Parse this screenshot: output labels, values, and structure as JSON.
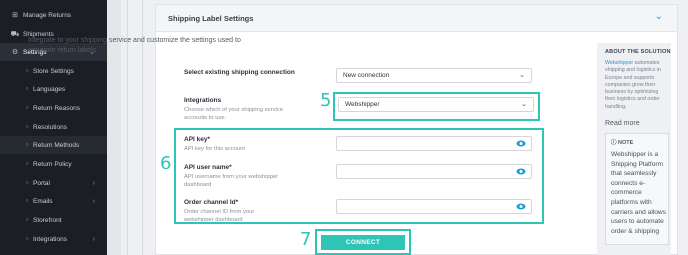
{
  "sidebar": {
    "items": [
      {
        "label": "Manage Returns",
        "icon": "returns-icon",
        "glyph": "⊞"
      },
      {
        "label": "Shipments",
        "icon": "truck-icon",
        "glyph": "⛟"
      },
      {
        "label": "Settings",
        "icon": "gear-icon",
        "glyph": "⚙"
      },
      {
        "label": "Store Settings",
        "icon": "dot-icon",
        "glyph": "○"
      },
      {
        "label": "Languages",
        "icon": "dot-icon",
        "glyph": "○"
      },
      {
        "label": "Return Reasons",
        "icon": "dot-icon",
        "glyph": "○"
      },
      {
        "label": "Resolutions",
        "icon": "dot-icon",
        "glyph": "○"
      },
      {
        "label": "Return Methods",
        "icon": "dot-icon",
        "glyph": "○"
      },
      {
        "label": "Return Policy",
        "icon": "dot-icon",
        "glyph": "○"
      },
      {
        "label": "Portal",
        "icon": "dot-icon",
        "glyph": "○"
      },
      {
        "label": "Emails",
        "icon": "dot-icon",
        "glyph": "○"
      },
      {
        "label": "Storefront",
        "icon": "dot-icon",
        "glyph": "○"
      },
      {
        "label": "Integrations",
        "icon": "dot-icon",
        "glyph": "○"
      }
    ]
  },
  "panel": {
    "title": "Shipping Label Settings",
    "intro": "Integrate to your shipping service and customize the settings used to generate return labels.",
    "existing_connection": {
      "label": "Select existing shipping connection",
      "value": "New connection"
    },
    "integrations": {
      "label": "Integrations",
      "help": "Choose which of your shipping service accounts to use.",
      "value": "Webshipper"
    },
    "api_key": {
      "label": "API key*",
      "help": "API key for this account"
    },
    "api_user": {
      "label": "API user name*",
      "help": "API username from your webshipper dashboard"
    },
    "order_channel": {
      "label": "Order channel Id*",
      "help": "Order channel ID from your webshipper dashboard"
    },
    "connect_label": "CONNECT"
  },
  "annotations": {
    "step5": "5",
    "step6": "6",
    "step7": "7"
  },
  "aside": {
    "title": "ABOUT THE SOLUTION",
    "brand": "Webshipper",
    "body": "automates shipping and logistics in Europe and supports companies grow their business by optimizing their logistics and order handling.",
    "read_more": "Read more",
    "note_title": "NOTE",
    "note_body": "Webshipper is a Shipping Platform that seamlessly connects e-commerce platforms with carriers and allows users to automate order & shipping"
  },
  "colors": {
    "accent": "#2ec4b6",
    "link": "#1f9bd6",
    "sidebar_bg": "#1b1e24"
  }
}
